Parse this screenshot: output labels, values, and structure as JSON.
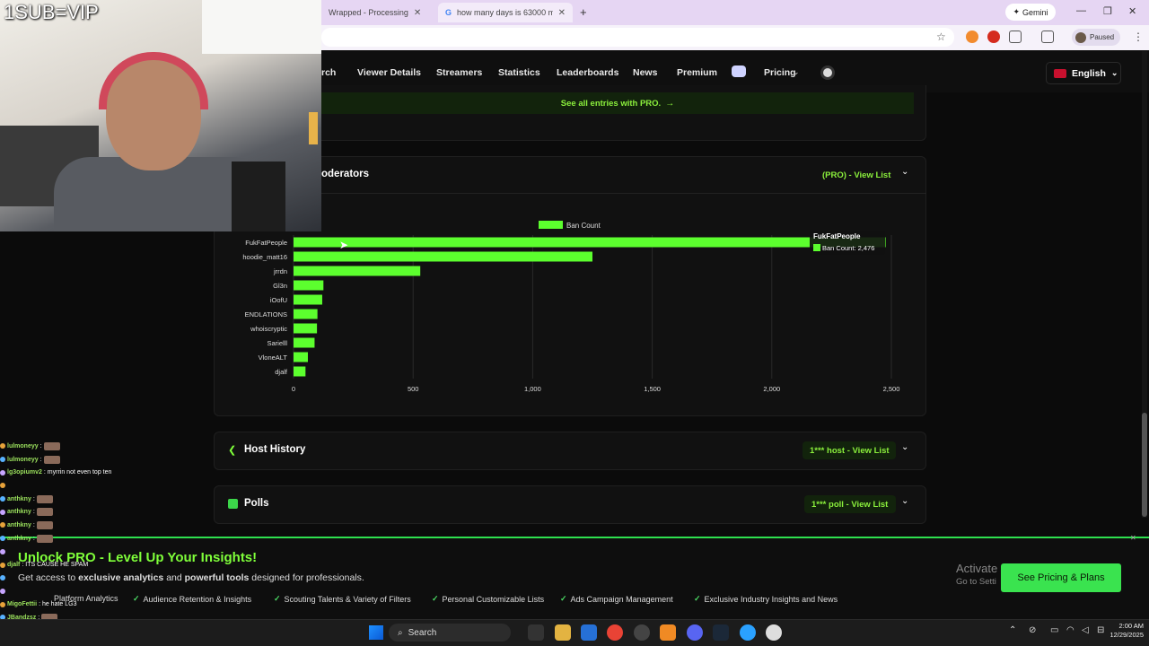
{
  "browser": {
    "tabs": [
      {
        "label": "Wrapped - Processing"
      },
      {
        "label": "how many days is 63000 minut"
      }
    ],
    "new_tab": "+",
    "gemini_label": "Gemini",
    "profile_status": "Paused"
  },
  "stream": {
    "sub_text": "1SUB=VIP"
  },
  "nav": {
    "items": [
      "rch",
      "Viewer Details",
      "Streamers",
      "Statistics",
      "Leaderboards",
      "News",
      "Premium",
      "Pricing"
    ],
    "language": "English"
  },
  "see_all": {
    "label": "See all entries with PRO."
  },
  "moderators": {
    "title": "oderators",
    "action": "(PRO) - View List"
  },
  "chart_data": {
    "type": "bar",
    "orientation": "horizontal",
    "legend": [
      "Ban Count"
    ],
    "categories": [
      "FukFatPeople",
      "hoodie_matt16",
      "jrrdn",
      "Gl3n",
      "iOofU",
      "ENDLATIONS",
      "whoiscryptic",
      "Sarielll",
      "VloneALT",
      "djalf"
    ],
    "series": [
      {
        "name": "Ban Count",
        "values": [
          2476,
          1250,
          530,
          125,
          120,
          100,
          98,
          88,
          60,
          50
        ]
      }
    ],
    "xticks": [
      "0",
      "500",
      "1,000",
      "1,500",
      "2,000",
      "2,500"
    ],
    "xlim": [
      0,
      2500
    ],
    "grid": true,
    "tooltip": {
      "title": "FukFatPeople",
      "text": "Ban Count: 2,476"
    },
    "colors": {
      "bar": "#5cff2e"
    }
  },
  "host_history": {
    "title": "Host History",
    "action": "1*** host - View List"
  },
  "polls": {
    "title": "Polls",
    "action": "1*** poll - View List"
  },
  "chat": [
    {
      "user": "lulmoneyy",
      "msg": ":"
    },
    {
      "user": "lulmoneyy",
      "msg": ":"
    },
    {
      "user": "lg3opiumv2",
      "msg": ": myrrin not even top ten"
    },
    {
      "user": "",
      "msg": ""
    },
    {
      "user": "anthkny",
      "msg": ":"
    },
    {
      "user": "anthkny",
      "msg": ":"
    },
    {
      "user": "anthkny",
      "msg": ":"
    },
    {
      "user": "anthkny",
      "msg": ":"
    },
    {
      "user": "",
      "msg": ""
    },
    {
      "user": "djalf",
      "msg": ": ITS CAUSE HE SPAM"
    },
    {
      "user": "",
      "msg": ""
    },
    {
      "user": "",
      "msg": ""
    },
    {
      "user": "MigoFettii",
      "msg": ": he hate LG3"
    },
    {
      "user": "JBandzsz",
      "msg": ":"
    }
  ],
  "promo": {
    "title": "Unlock PRO - Level Up Your Insights!",
    "subtitle_pre": "Get access to ",
    "subtitle_b1": "exclusive analytics",
    "subtitle_mid": " and ",
    "subtitle_b2": "powerful tools",
    "subtitle_post": " designed for professionals.",
    "features": [
      "Platform Analytics",
      "Audience Retention & Insights",
      "Scouting Talents & Variety of Filters",
      "Personal Customizable Lists",
      "Ads Campaign Management",
      "Exclusive Industry Insights and News"
    ],
    "cta": "See Pricing & Plans",
    "activate_title": "Activate",
    "activate_sub": "Go to Setti"
  },
  "taskbar": {
    "search": "Search",
    "time": "2:00 AM",
    "date": "12/29/2025"
  }
}
